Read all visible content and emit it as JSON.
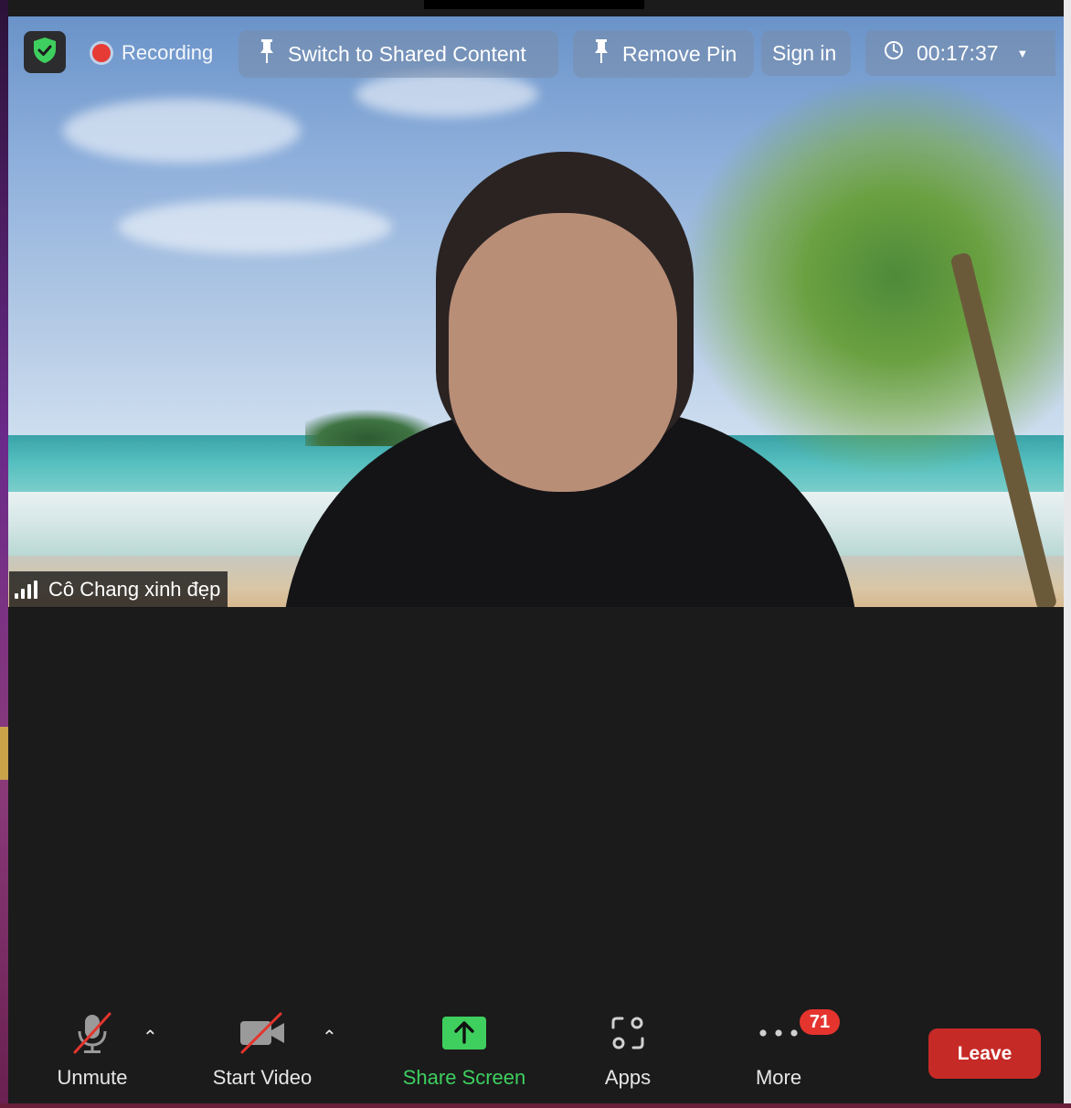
{
  "meeting": {
    "recording_label": "Recording",
    "switch_label": "Switch to Shared Content",
    "remove_pin_label": "Remove Pin",
    "sign_in_label": "Sign in",
    "timer": "00:17:37"
  },
  "participant": {
    "name": "Cô Chang xinh đẹp"
  },
  "toolbar": {
    "unmute_label": "Unmute",
    "start_video_label": "Start Video",
    "share_screen_label": "Share Screen",
    "apps_label": "Apps",
    "more_label": "More",
    "more_badge": "71",
    "leave_label": "Leave"
  },
  "colors": {
    "share_green": "#3ecf5e",
    "leave_red": "#c62a26",
    "badge_red": "#e5342e",
    "recording_red": "#e63a35"
  },
  "icons": [
    "shield-check-icon",
    "recording-dot-icon",
    "pin-icon",
    "clock-icon",
    "signal-bars-icon",
    "muted-mic-icon",
    "video-off-icon",
    "share-screen-icon",
    "apps-icon",
    "more-dots-icon"
  ]
}
